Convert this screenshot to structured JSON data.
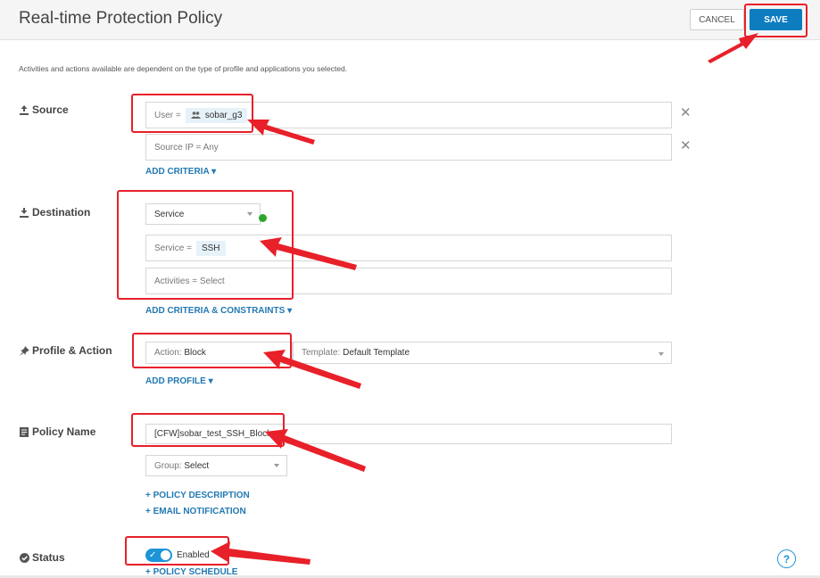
{
  "header": {
    "title": "Real-time Protection Policy",
    "cancel_label": "CANCEL",
    "save_label": "SAVE"
  },
  "subtext": "Activities and actions available are dependent on the type of profile and applications you selected.",
  "source": {
    "label": "Source",
    "user_prefix": "User =",
    "user_value": "sobar_g3",
    "ip_text": "Source IP = Any",
    "add_criteria": "ADD CRITERIA"
  },
  "destination": {
    "label": "Destination",
    "type_select": "Service",
    "service_prefix": "Service =",
    "service_value": "SSH",
    "activities_text": "Activities = Select",
    "add_link": "ADD CRITERIA & CONSTRAINTS"
  },
  "profile": {
    "label": "Profile & Action",
    "action_prefix": "Action:",
    "action_value": "Block",
    "template_prefix": "Template:",
    "template_value": "Default Template",
    "add_profile": "ADD PROFILE"
  },
  "policy": {
    "label": "Policy Name",
    "name_value": "[CFW]sobar_test_SSH_Block",
    "group_prefix": "Group:",
    "group_value": "Select",
    "description_link": "+ POLICY DESCRIPTION",
    "email_link": "+ EMAIL NOTIFICATION"
  },
  "status": {
    "label": "Status",
    "toggle_text": "Enabled",
    "toggle_on": true,
    "schedule_link": "+ POLICY SCHEDULE"
  },
  "icons": {
    "source": "upload-icon",
    "destination": "download-icon",
    "profile": "pushpin-icon",
    "policy": "document-icon",
    "status": "check-circle-icon",
    "help": "help-icon"
  },
  "colors": {
    "primary": "#0d7dc0",
    "link": "#2379b3",
    "annotation": "#e8202a",
    "status_dot": "#2ea62e"
  }
}
